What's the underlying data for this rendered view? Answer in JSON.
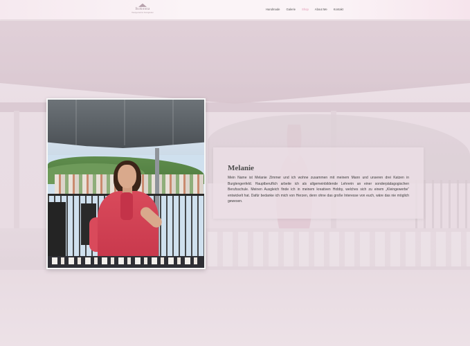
{
  "header": {
    "logo": {
      "name": "Ikokonna",
      "tagline": "Handgemachte Kleinigkeiten"
    },
    "nav": [
      {
        "label": "Handmade",
        "active": false
      },
      {
        "label": "Galerie",
        "active": false
      },
      {
        "label": "Shop",
        "active": true
      },
      {
        "label": "About Me",
        "active": false
      },
      {
        "label": "Kontakt",
        "active": false
      }
    ]
  },
  "about": {
    "title": "Melanie",
    "body": "Mein Name ist Melanie Zimmer und ich wohne zusammen mit meinem Mann und unseren drei Katzen in Burglengenfeld. Hauptberuflich arbeite ich als allgemeinbildende Lehrerin an einer sonderpädagogischen Berufsschule. Meinen Ausgleich finde ich in meinem kreativen Hobby, welches sich zu einem „Kleingewerbe“ entwickelt hat. Dafür bedanke ich mich von Herzen, denn ohne das große Interesse von euch, wäre das nie möglich gewesen."
  },
  "colors": {
    "accent": "#e39ab5",
    "header_bg": "#fbf4f7",
    "card_bg": "#ecdfe5",
    "text": "#3b3b3b"
  }
}
